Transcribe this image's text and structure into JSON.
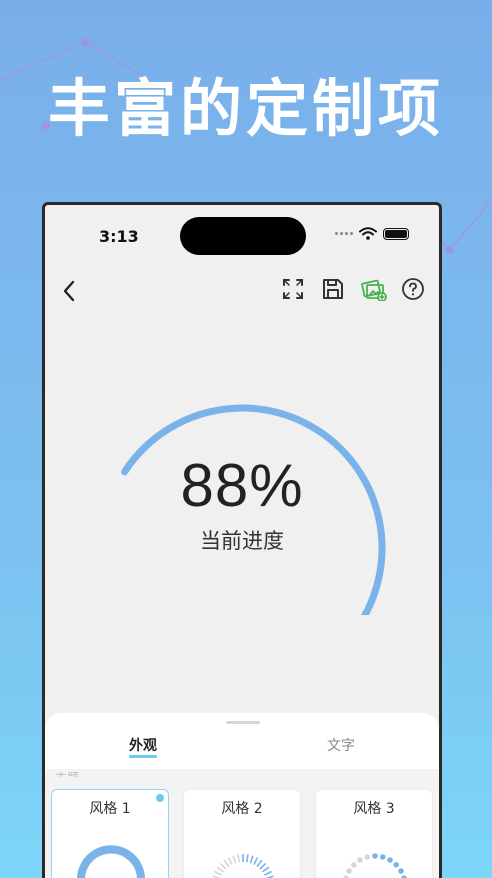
{
  "headline": "丰富的定制项",
  "status_bar": {
    "time": "3:13"
  },
  "nav": {
    "back_icon": "chevron-left-icon",
    "actions": [
      "fullscreen-icon",
      "save-icon",
      "image-add-icon",
      "help-icon"
    ]
  },
  "gauge": {
    "value_text": "88%",
    "progress": 0.88,
    "label": "当前进度",
    "track_color": "#dcdcdc",
    "fill_color": "#7ab3ea"
  },
  "sheet": {
    "tabs": [
      {
        "label": "外观",
        "active": true
      },
      {
        "label": "文字",
        "active": false
      }
    ],
    "partial_label": "主题",
    "styles": [
      {
        "label": "风格 1",
        "selected": true
      },
      {
        "label": "风格 2",
        "selected": false
      },
      {
        "label": "风格 3",
        "selected": false
      }
    ]
  },
  "colors": {
    "accent": "#6cc8f0",
    "gauge_blue": "#7ab3ea"
  }
}
